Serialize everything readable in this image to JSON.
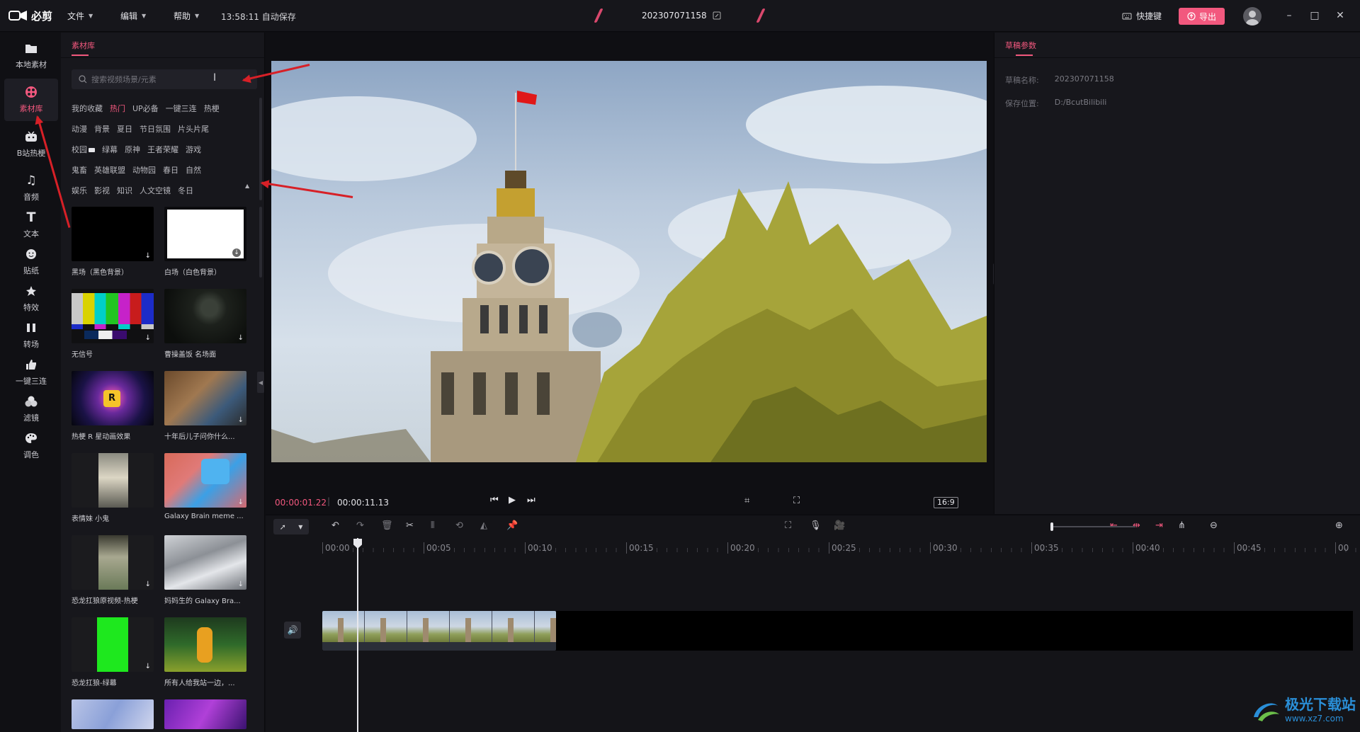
{
  "app": {
    "logo_text": "必剪",
    "menus": [
      "文件",
      "编辑",
      "帮助"
    ],
    "autosave": "13:58:11 自动保存",
    "doc_title": "202307071158",
    "shortcut_label": "快捷键",
    "export_label": "导出"
  },
  "nav": {
    "items": [
      {
        "label": "本地素材",
        "icon": "folder-icon"
      },
      {
        "label": "素材库",
        "icon": "material-library-icon",
        "active": true
      },
      {
        "label": "B站热梗",
        "icon": "bilibili-tv-icon"
      },
      {
        "label": "音频",
        "icon": "music-note-icon"
      },
      {
        "label": "文本",
        "icon": "text-t-icon"
      },
      {
        "label": "贴纸",
        "icon": "sticker-icon"
      },
      {
        "label": "特效",
        "icon": "effects-icon"
      },
      {
        "label": "转场",
        "icon": "transition-icon"
      },
      {
        "label": "一键三连",
        "icon": "thumbs-up-icon"
      },
      {
        "label": "滤镜",
        "icon": "filter-icon"
      },
      {
        "label": "调色",
        "icon": "palette-icon"
      }
    ]
  },
  "material": {
    "tab_label": "素材库",
    "search_placeholder": "搜索视频场景/元素",
    "tag_rows": [
      [
        "我的收藏",
        "热门",
        "UP必备",
        "一键三连",
        "热梗"
      ],
      [
        "动漫",
        "背景",
        "夏日",
        "节日氛围",
        "片头片尾"
      ],
      [
        "校园",
        "绿幕",
        "原神",
        "王者荣耀",
        "游戏"
      ],
      [
        "鬼畜",
        "英雄联盟",
        "动物园",
        "春日",
        "自然"
      ],
      [
        "娱乐",
        "影视",
        "知识",
        "人文空镜",
        "冬日"
      ]
    ],
    "active_tag": "热门",
    "items": [
      {
        "label": "黑场（黑色背景）"
      },
      {
        "label": "白场（白色背景）"
      },
      {
        "label": "无信号"
      },
      {
        "label": "曹操盖饭 名场面"
      },
      {
        "label": "热梗 R 星动画效果"
      },
      {
        "label": "十年后儿子问你什么..."
      },
      {
        "label": "表情妹 小鬼"
      },
      {
        "label": "Galaxy Brain meme ..."
      },
      {
        "label": "恐龙扛狼原视频-热梗"
      },
      {
        "label": "妈妈生的 Galaxy Bra..."
      },
      {
        "label": "恐龙扛狼-绿幕"
      },
      {
        "label": "所有人给我站一边，..."
      }
    ]
  },
  "preview": {
    "current_time": "00:00:01.22",
    "total_time": "00:00:11.13",
    "ratio": "16:9"
  },
  "params": {
    "tab_label": "草稿参数",
    "name_key": "草稿名称:",
    "name_value": "202307071158",
    "path_key": "保存位置:",
    "path_value": "D:/BcutBilibili"
  },
  "timeline": {
    "ticks": [
      "00:00",
      "00:05",
      "00:10",
      "00:15",
      "00:20",
      "00:25",
      "00:30",
      "00:35",
      "00:40",
      "00:45",
      "00"
    ]
  },
  "watermark": {
    "text": "极光下载站",
    "url": "www.xz7.com"
  },
  "colors": {
    "accent": "#f2587e",
    "background": "#0e0e12",
    "panel": "#17171c",
    "annotation_arrow": "#d72027"
  }
}
